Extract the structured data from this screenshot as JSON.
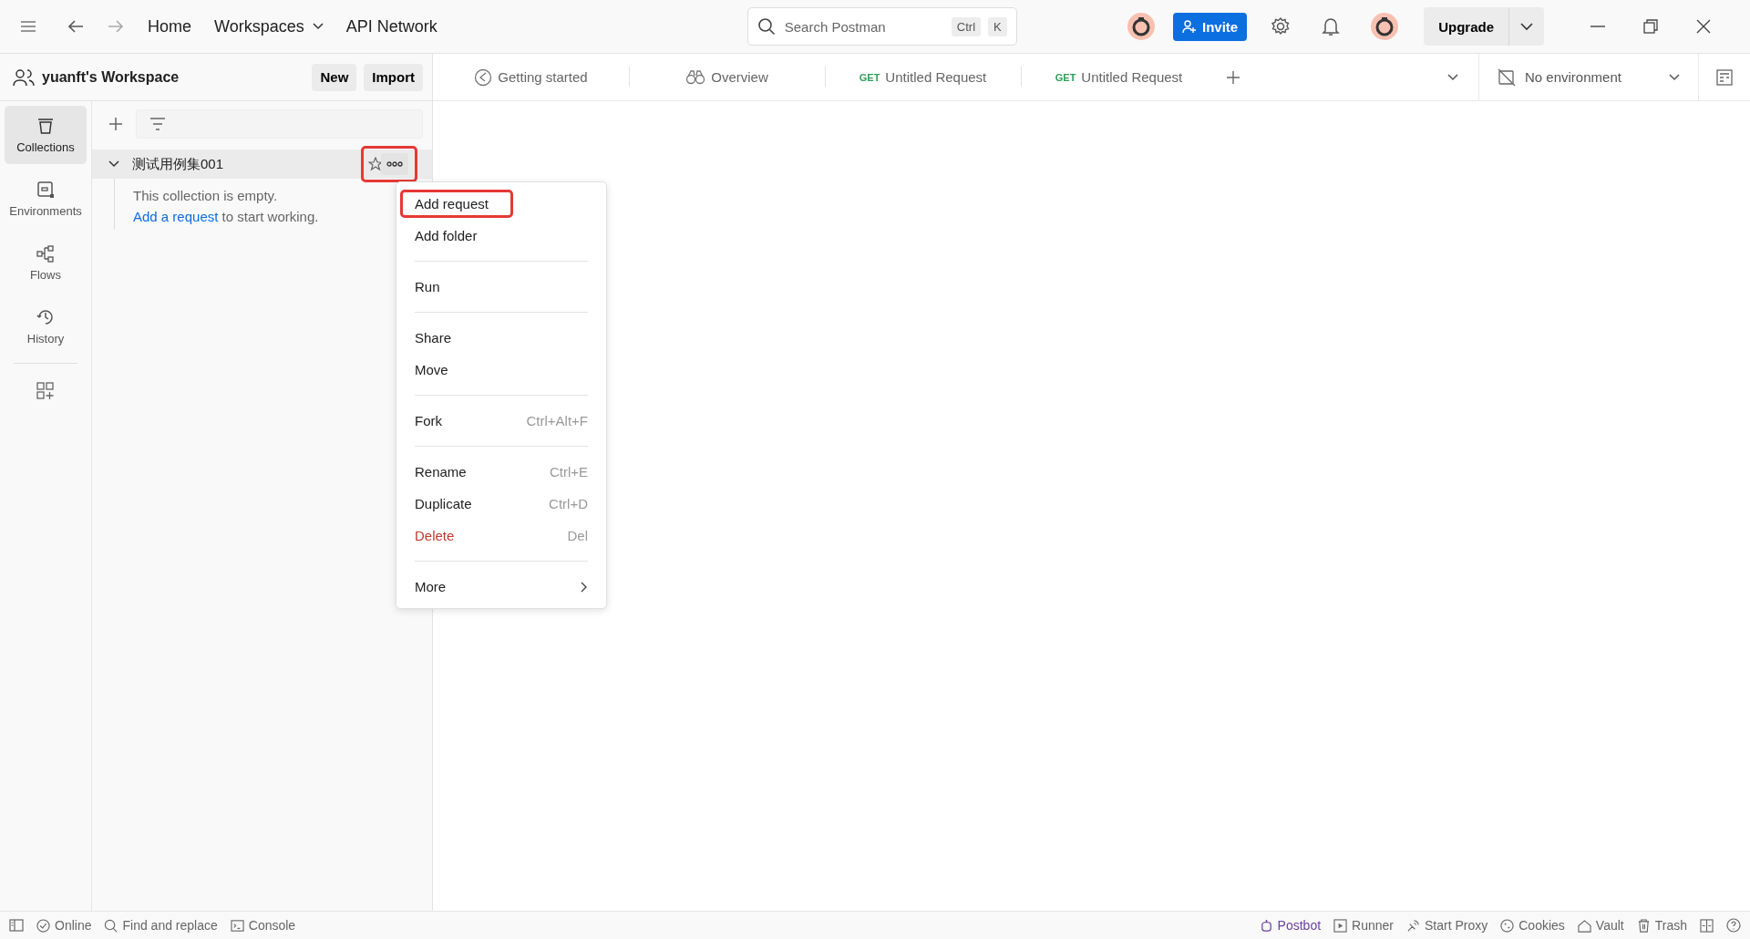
{
  "topbar": {
    "nav": [
      {
        "label": "Home",
        "dropdown": false
      },
      {
        "label": "Workspaces",
        "dropdown": true
      },
      {
        "label": "API Network",
        "dropdown": false
      }
    ],
    "search": {
      "placeholder": "Search Postman",
      "keys": [
        "Ctrl",
        "K"
      ]
    },
    "invite": "Invite",
    "upgrade": "Upgrade"
  },
  "workspace": {
    "name": "yuanft's Workspace",
    "buttons": [
      "New",
      "Import"
    ]
  },
  "tabs": [
    {
      "kind": "guide",
      "label": "Getting started"
    },
    {
      "kind": "overview",
      "label": "Overview"
    },
    {
      "kind": "request",
      "method": "GET",
      "label": "Untitled Request"
    },
    {
      "kind": "request",
      "method": "GET",
      "label": "Untitled Request"
    }
  ],
  "environment": "No environment",
  "rail": [
    {
      "kind": "collections",
      "label": "Collections",
      "selected": true
    },
    {
      "kind": "environments",
      "label": "Environments",
      "selected": false
    },
    {
      "kind": "flows",
      "label": "Flows",
      "selected": false
    },
    {
      "kind": "history",
      "label": "History",
      "selected": false
    }
  ],
  "collection": {
    "name": "测试用例集001",
    "expanded": true,
    "more_highlighted": true,
    "empty_text": "This collection is empty.",
    "link": "Add a request",
    "link_rest": "to start working."
  },
  "menu": [
    [
      {
        "label": "Add request",
        "highlighted": true
      },
      {
        "label": "Add folder",
        "highlighted": false
      }
    ],
    [
      {
        "label": "Run",
        "highlighted": false
      }
    ],
    [
      {
        "label": "Share",
        "highlighted": false
      },
      {
        "label": "Move",
        "highlighted": false
      }
    ],
    [
      {
        "label": "Fork",
        "shortcut": "Ctrl+Alt+F",
        "highlighted": false
      }
    ],
    [
      {
        "label": "Rename",
        "shortcut": "Ctrl+E",
        "highlighted": false
      },
      {
        "label": "Duplicate",
        "shortcut": "Ctrl+D",
        "highlighted": false
      },
      {
        "label": "Delete",
        "shortcut": "Del",
        "danger": true,
        "highlighted": false
      }
    ],
    [
      {
        "label": "More",
        "submenu": true,
        "highlighted": false
      }
    ]
  ],
  "status_left": [
    {
      "kind": "online",
      "label": "Online"
    },
    {
      "kind": "find",
      "label": "Find and replace"
    },
    {
      "kind": "console",
      "label": "Console"
    }
  ],
  "status_right": [
    {
      "kind": "postbot",
      "label": "Postbot"
    },
    {
      "kind": "runner",
      "label": "Runner"
    },
    {
      "kind": "proxy",
      "label": "Start Proxy"
    },
    {
      "kind": "cookies",
      "label": "Cookies"
    },
    {
      "kind": "vault",
      "label": "Vault"
    },
    {
      "kind": "trash",
      "label": "Trash"
    }
  ]
}
